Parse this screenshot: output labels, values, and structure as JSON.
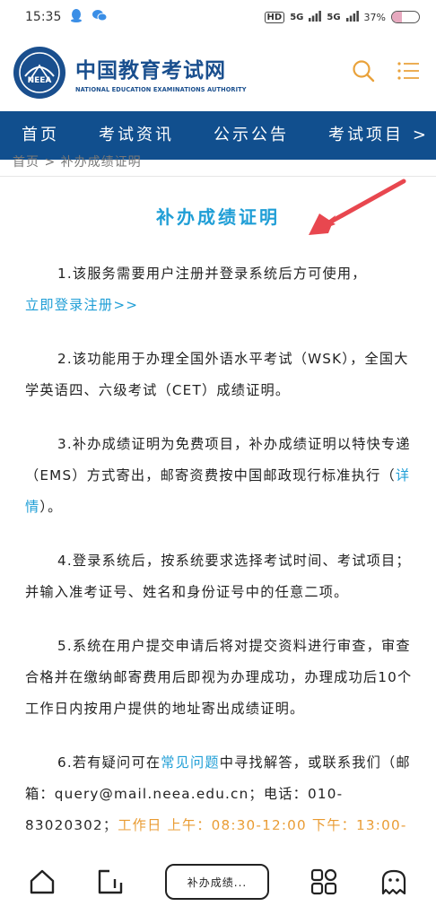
{
  "status": {
    "time": "15:35",
    "hd": "HD",
    "signal1": "5G",
    "signal2": "5G",
    "battery": "37%",
    "battery_level": 0.37
  },
  "header": {
    "logo_text": "NEEA",
    "site_title": "中国教育考试网",
    "site_subtitle": "NATIONAL EDUCATION EXAMINATIONS AUTHORITY"
  },
  "nav": {
    "items": [
      "首页",
      "考试资讯",
      "公示公告",
      "考试项目"
    ],
    "more": ">"
  },
  "breadcrumb": "首页 > 补办成绩证明",
  "page_title": "补办成绩证明",
  "paragraphs": {
    "p1": "1.该服务需要用户注册并登录系统后方可使用，",
    "p1_link": "立即登录注册>>",
    "p2": "2.该功能用于办理全国外语水平考试（WSK），全国大学英语四、六级考试（CET）成绩证明。",
    "p3_a": "3.补办成绩证明为免费项目，补办成绩证明以特快专递（EMS）方式寄出，邮寄资费按中国邮政现行标准执行（",
    "p3_link": "详情",
    "p3_b": "）。",
    "p4": "4.登录系统后，按系统要求选择考试时间、考试项目；并输入准考证号、姓名和身份证号中的任意二项。",
    "p5": "5.系统在用户提交申请后将对提交资料进行审查，审查合格并在缴纳邮寄费用后即视为办理成功，办理成功后10个工作日内按用户提供的地址寄出成绩证明。",
    "p6_a": "6.若有疑问可在",
    "p6_link": "常见问题",
    "p6_b": "中寻找解答，或联系我们（邮箱：query@mail.neea.edu.cn；电话：010-83020302；",
    "p6_hours": "工作日 上午：08:30-12:00 下午：13:00-"
  },
  "bottom_bar": {
    "tab_label": "补办成绩..."
  },
  "colors": {
    "nav_bg": "#114f8e",
    "title": "#1f9ed6",
    "accent_orange": "#e9a23b",
    "arrow_red": "#e8474f"
  },
  "icons": {
    "search": "search-icon",
    "menu": "menu-icon",
    "home": "home-icon",
    "tabs": "tabs-icon",
    "apps": "apps-icon",
    "assistant": "assistant-icon"
  }
}
